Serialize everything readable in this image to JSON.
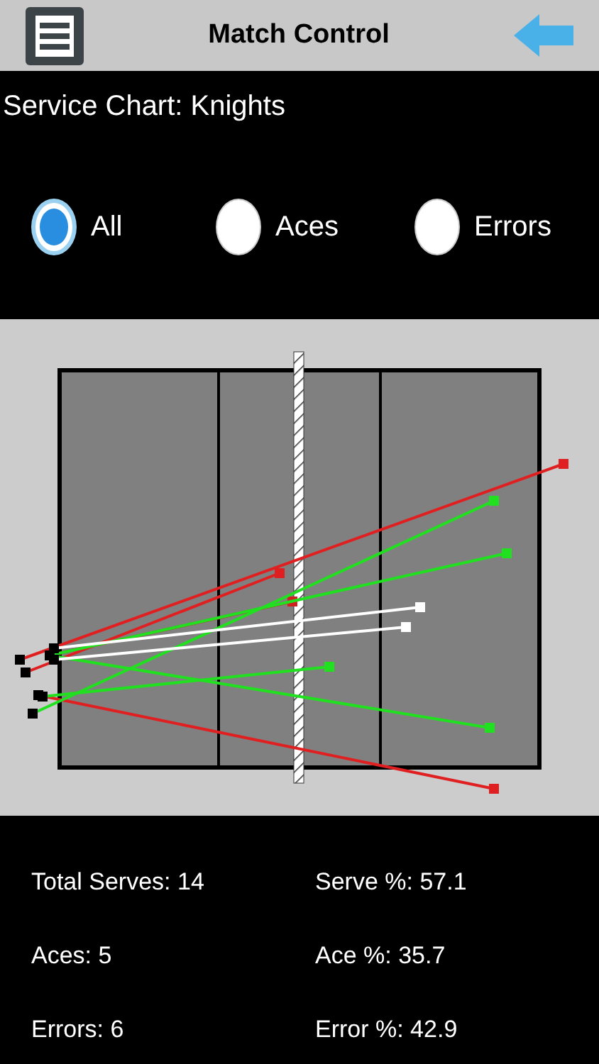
{
  "header": {
    "title": "Match Control"
  },
  "chart_title": "Service Chart: Knights",
  "filters": [
    {
      "label": "All",
      "selected": true
    },
    {
      "label": "Aces",
      "selected": false
    },
    {
      "label": "Errors",
      "selected": false
    }
  ],
  "stats": [
    {
      "label": "Total Serves: 14"
    },
    {
      "label": "Serve %: 57.1"
    },
    {
      "label": "Aces: 5"
    },
    {
      "label": "Ace %: 35.7"
    },
    {
      "label": "Errors: 6"
    },
    {
      "label": "Error %: 42.9"
    }
  ]
}
